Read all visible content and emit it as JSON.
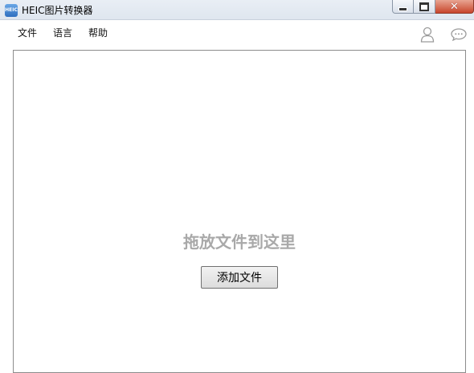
{
  "window": {
    "title": "HEIC图片转换器",
    "app_icon_text": "HEIC",
    "controls": {
      "close_glyph": "✕"
    }
  },
  "menu": {
    "file": "文件",
    "language": "语言",
    "help": "帮助"
  },
  "toolbar_icons": [
    "user-icon",
    "chat-icon"
  ],
  "drop_area": {
    "hint": "拖放文件到这里",
    "add_button_label": "添加文件"
  },
  "colors": {
    "hint_text": "#a9a9a9",
    "close_button": "#c8452c",
    "border": "#8c8c8c"
  }
}
